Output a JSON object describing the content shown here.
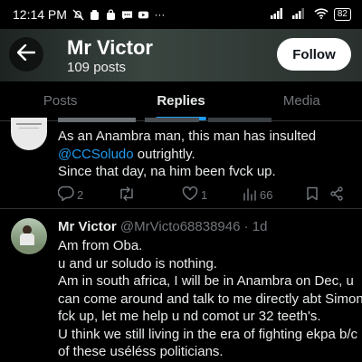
{
  "status_bar": {
    "time": "12:14 PM",
    "battery": "82"
  },
  "header": {
    "title": "Mr Victor",
    "subtitle": "109 posts",
    "follow_label": "Follow"
  },
  "tabs": [
    {
      "label": "Posts",
      "active": false
    },
    {
      "label": "Replies",
      "active": true
    },
    {
      "label": "Media",
      "active": false
    }
  ],
  "tweets": [
    {
      "lines": [
        {
          "pre": "As an Anambra man, this man has insulted",
          "mention": ""
        },
        {
          "pre": "",
          "mention": "@CCSoludo",
          "post": " outrightly."
        },
        {
          "pre": "Since that day, na him been fvck up.",
          "mention": ""
        }
      ],
      "counts": {
        "replies": "2",
        "retweets": "",
        "likes": "1",
        "views": "66"
      }
    },
    {
      "name": "Mr Victor",
      "handle": "@MrVicto68838946",
      "time": "· 1d",
      "lines": [
        "Am from Oba.",
        "u and ur soludo is nothing.",
        "Am in south africa, I will be in Anambra on Dec, u",
        "can come around and talk to me directly abt Simon",
        "fck up, let me help u nd comot ur 32 teeth's.",
        "U think we still living in the era of fighting ekpa b/c",
        "of these uséléss politicians."
      ]
    }
  ],
  "colors": {
    "accent": "#1d9bf0",
    "muted": "#71767b",
    "text": "#e7e9ea",
    "background": "#000000"
  },
  "icons": [
    "back-arrow-icon",
    "reply-icon",
    "retweet-icon",
    "like-icon",
    "views-icon",
    "bookmark-icon",
    "share-icon"
  ]
}
